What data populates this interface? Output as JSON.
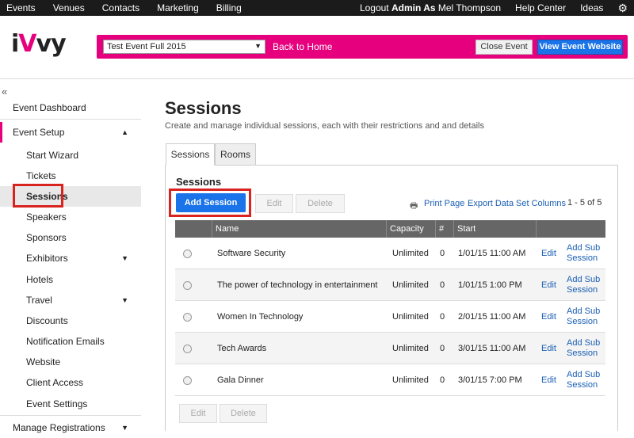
{
  "topnav": {
    "left": [
      "Events",
      "Venues",
      "Contacts",
      "Marketing",
      "Billing"
    ],
    "logout": "Logout",
    "admin_as": "Admin As",
    "user": "Mel Thompson",
    "help": "Help Center",
    "ideas": "Ideas",
    "settings_icon": "gear-icon"
  },
  "header": {
    "logo": "iVvy",
    "event_select": "Test Event Full 2015",
    "back_home": "Back to Home",
    "close_event": "Close Event",
    "view_website": "View Event Website"
  },
  "sidebar": {
    "collapse": "«",
    "items": [
      {
        "label": "Event Dashboard"
      },
      {
        "label": "Event Setup"
      },
      {
        "label": "Start Wizard"
      },
      {
        "label": "Tickets"
      },
      {
        "label": "Sessions"
      },
      {
        "label": "Speakers"
      },
      {
        "label": "Sponsors"
      },
      {
        "label": "Exhibitors"
      },
      {
        "label": "Hotels"
      },
      {
        "label": "Travel"
      },
      {
        "label": "Discounts"
      },
      {
        "label": "Notification Emails"
      },
      {
        "label": "Website"
      },
      {
        "label": "Client Access"
      },
      {
        "label": "Event Settings"
      },
      {
        "label": "Manage Registrations"
      }
    ]
  },
  "page": {
    "title": "Sessions",
    "subtitle": "Create and manage individual sessions, each with their restrictions and and details",
    "tabs": [
      "Sessions",
      "Rooms"
    ],
    "section_title": "Sessions",
    "add_session": "Add Session",
    "edit": "Edit",
    "delete": "Delete",
    "print_page": "Print Page",
    "export_data": "Export Data",
    "set_columns": "Set Columns",
    "pager": "1 - 5 of 5"
  },
  "table": {
    "headers": [
      "Name",
      "Capacity",
      "#",
      "Start"
    ],
    "rows": [
      {
        "name": "Software Security",
        "capacity": "Unlimited",
        "count": "0",
        "start": "1/01/15 11:00 AM",
        "edit": "Edit",
        "add_sub1": "Add Sub",
        "add_sub2": "Session"
      },
      {
        "name": "The power of technology in entertainment",
        "capacity": "Unlimited",
        "count": "0",
        "start": "1/01/15 1:00 PM",
        "edit": "Edit",
        "add_sub1": "Add Sub",
        "add_sub2": "Session"
      },
      {
        "name": "Women In Technology",
        "capacity": "Unlimited",
        "count": "0",
        "start": "2/01/15 11:00 AM",
        "edit": "Edit",
        "add_sub1": "Add Sub",
        "add_sub2": "Session"
      },
      {
        "name": "Tech Awards",
        "capacity": "Unlimited",
        "count": "0",
        "start": "3/01/15 11:00 AM",
        "edit": "Edit",
        "add_sub1": "Add Sub",
        "add_sub2": "Session"
      },
      {
        "name": "Gala Dinner",
        "capacity": "Unlimited",
        "count": "0",
        "start": "3/01/15 7:00 PM",
        "edit": "Edit",
        "add_sub1": "Add Sub",
        "add_sub2": "Session"
      }
    ]
  },
  "colors": {
    "brand": "#e6007e",
    "primary": "#1a73e8",
    "highlight": "#d9231f"
  }
}
